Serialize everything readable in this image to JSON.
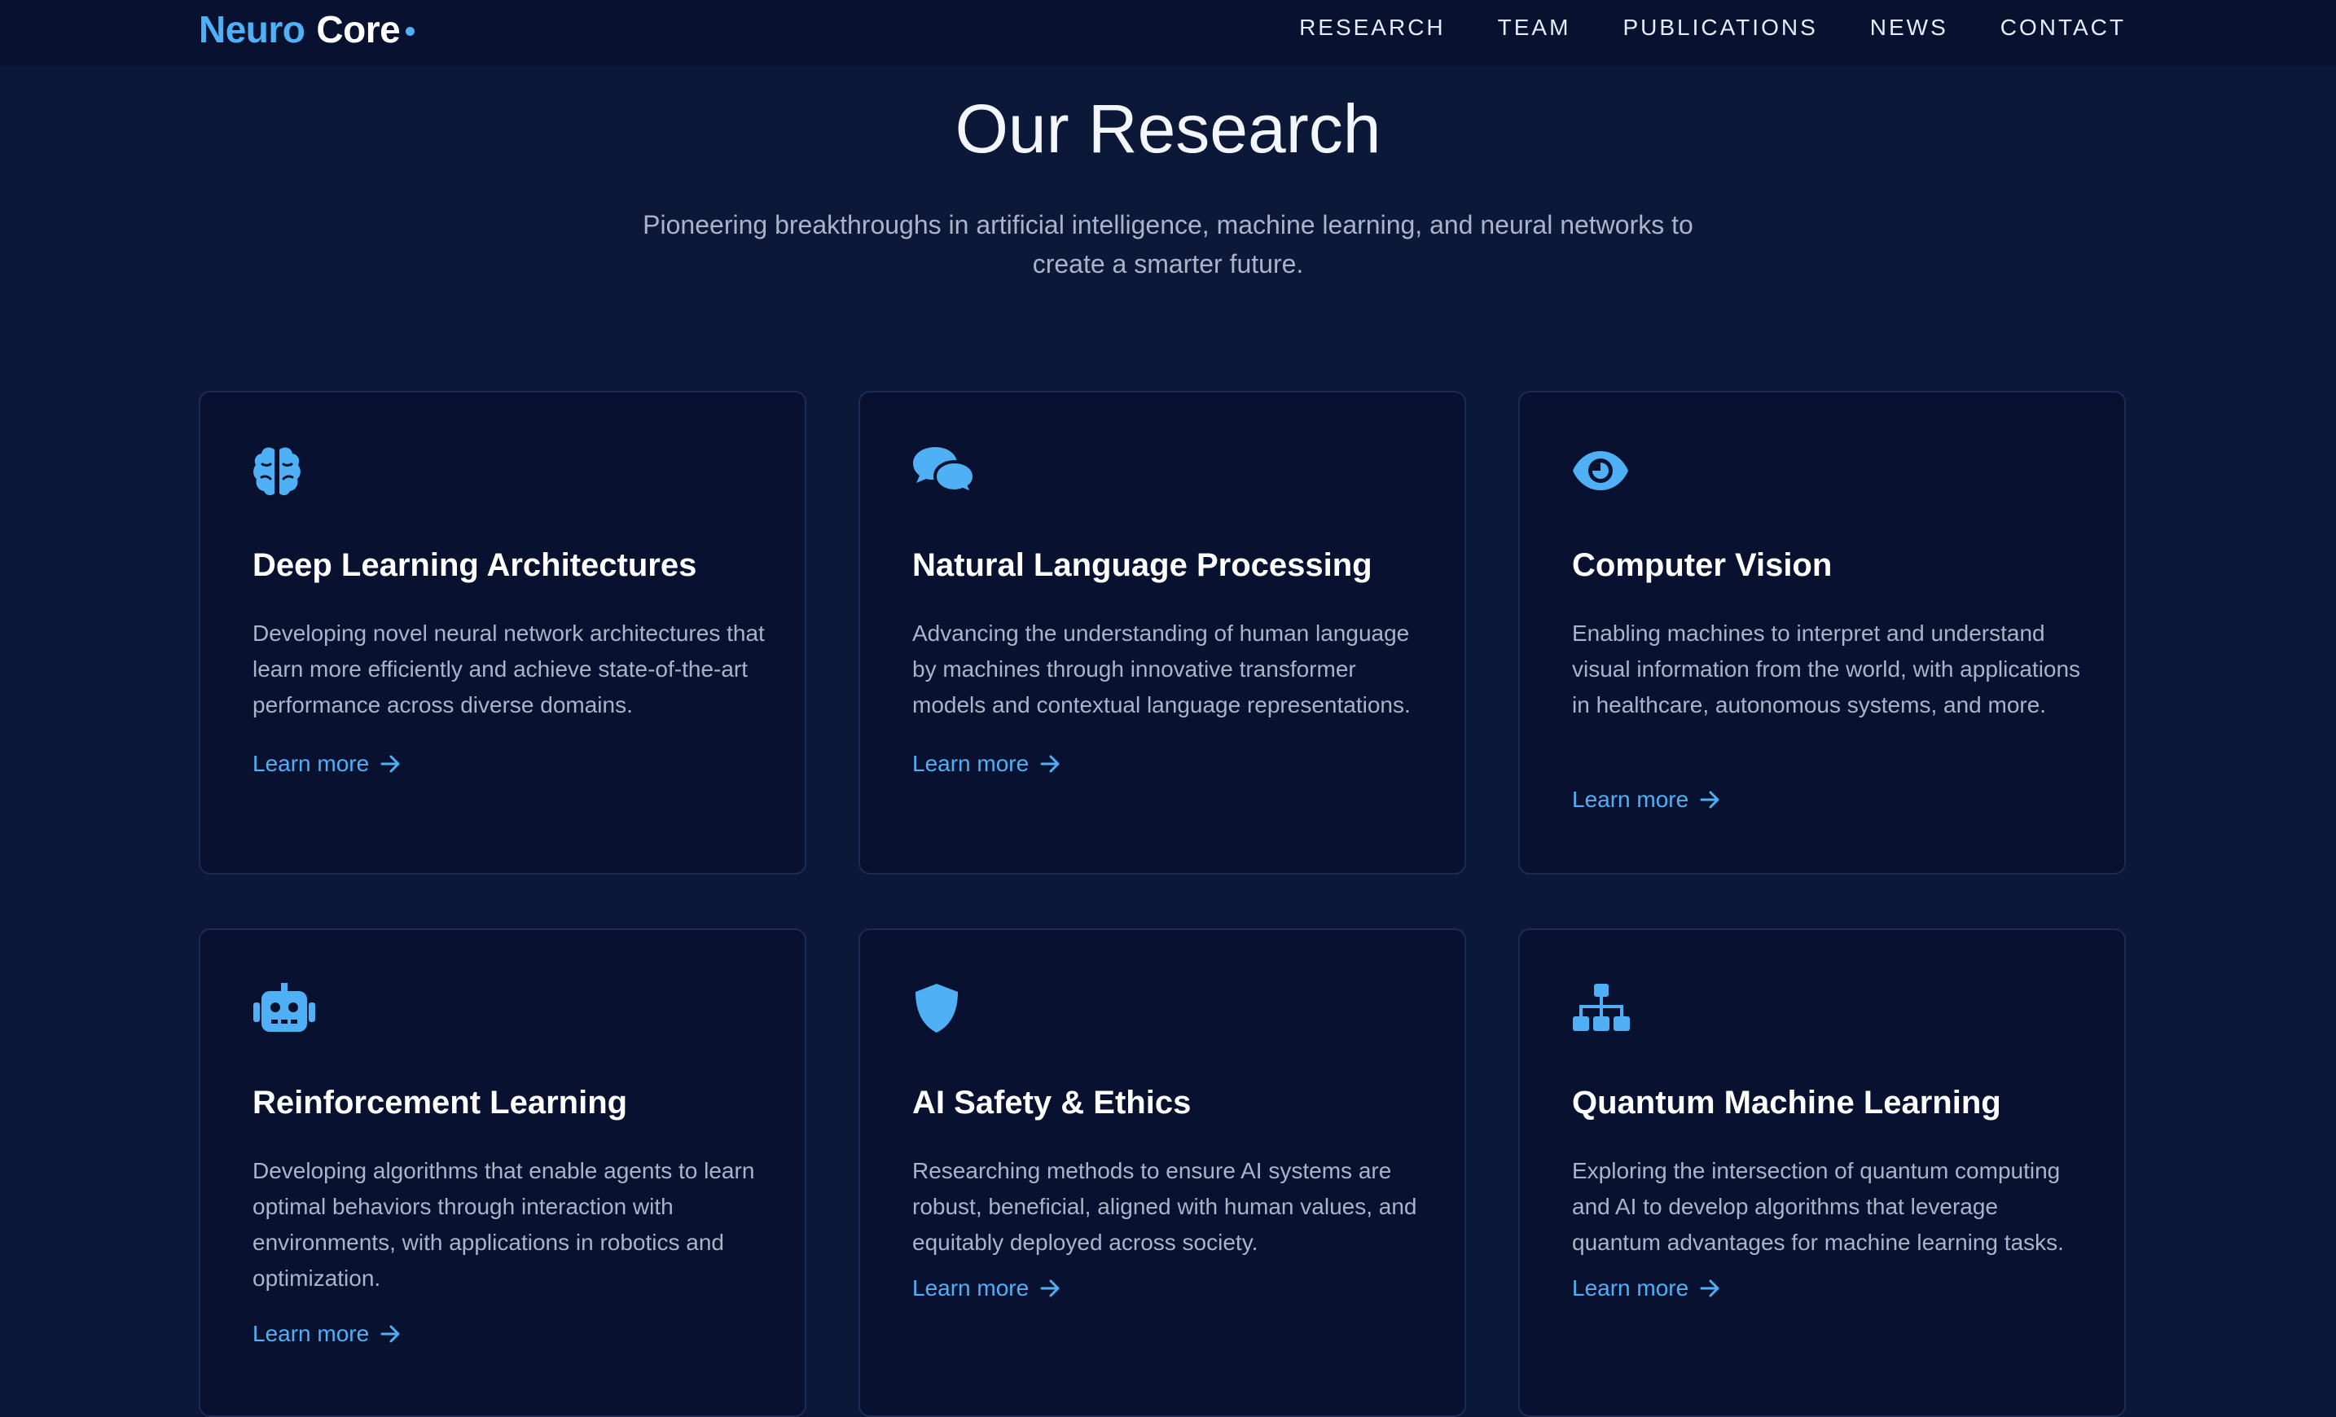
{
  "brand": {
    "part1": "Neuro",
    "part2": "Core"
  },
  "nav": [
    "RESEARCH",
    "TEAM",
    "PUBLICATIONS",
    "NEWS",
    "CONTACT"
  ],
  "hero": {
    "title": "Our Research",
    "subtitle_line1": "Pioneering breakthroughs in artificial intelligence, machine learning, and neural networks to",
    "subtitle_line2": "create a smarter future."
  },
  "colors": {
    "accent": "#4fb0f5",
    "background": "#0b1838",
    "card": "#081230",
    "border": "#1c2b52"
  },
  "cards": [
    {
      "icon": "brain-icon",
      "title": "Deep Learning Architectures",
      "description": "Developing novel neural network architectures that learn more efficiently and achieve state-of-the-art performance across diverse domains.",
      "link": "Learn more"
    },
    {
      "icon": "comments-icon",
      "title": "Natural Language Processing",
      "description": "Advancing the understanding of human language by machines through innovative transformer models and contextual language representations.",
      "link": "Learn more"
    },
    {
      "icon": "eye-icon",
      "title": "Computer Vision",
      "description": "Enabling machines to interpret and understand visual information from the world, with applications in healthcare, autonomous systems, and more.",
      "link": "Learn more"
    },
    {
      "icon": "robot-icon",
      "title": "Reinforcement Learning",
      "description": "Developing algorithms that enable agents to learn optimal behaviors through interaction with environments, with applications in robotics and optimization.",
      "link": "Learn more"
    },
    {
      "icon": "shield-icon",
      "title": "AI Safety & Ethics",
      "description": "Researching methods to ensure AI systems are robust, beneficial, aligned with human values, and equitably deployed across society.",
      "link": "Learn more"
    },
    {
      "icon": "sitemap-icon",
      "title": "Quantum Machine Learning",
      "description": "Exploring the intersection of quantum computing and AI to develop algorithms that leverage quantum advantages for machine learning tasks.",
      "link": "Learn more"
    }
  ]
}
